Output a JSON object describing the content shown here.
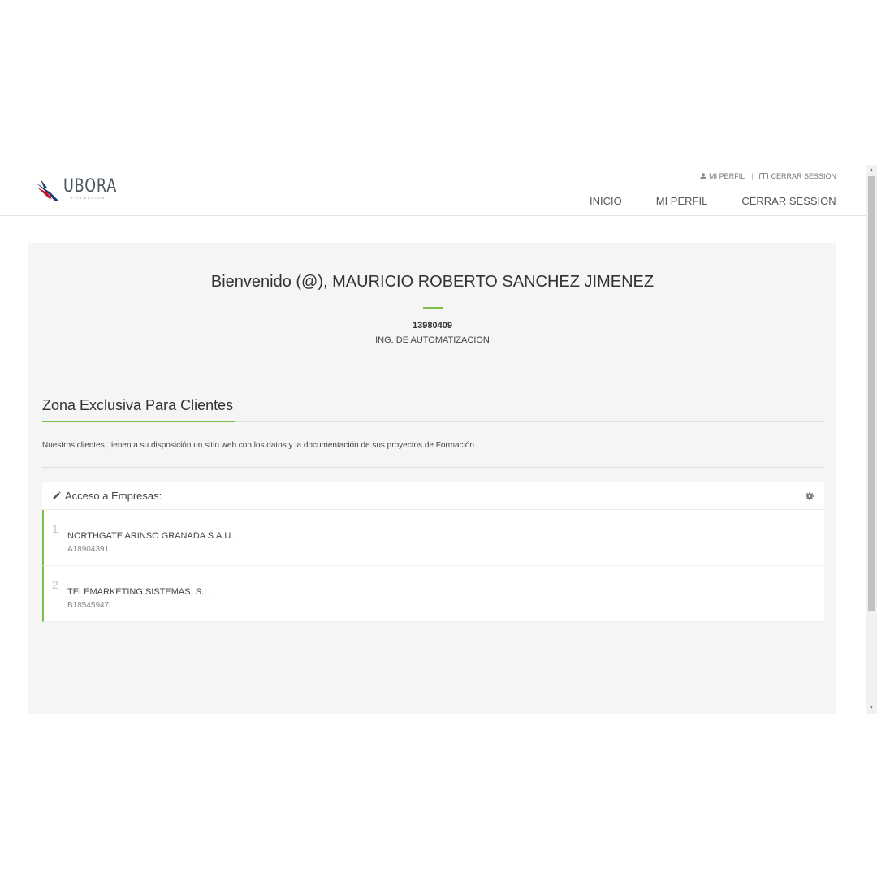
{
  "header": {
    "logo_text": "UBORA",
    "logo_sub": "FORMACION",
    "top_links": {
      "profile": "MI PERFIL",
      "separator": "|",
      "logout": "CERRAR SESSION"
    },
    "nav": [
      "INICIO",
      "MI PERFIL",
      "CERRAR SESSION"
    ]
  },
  "welcome": {
    "greeting": "Bienvenido (@), MAURICIO ROBERTO SANCHEZ JIMENEZ",
    "id": "13980409",
    "role": "ING. DE AUTOMATIZACION"
  },
  "section": {
    "title": "Zona Exclusiva Para Clientes",
    "description": "Nuestros clientes, tienen a su disposición un sitio web con los datos y la documentación de sus proyectos de Formación."
  },
  "card": {
    "title": "Acceso a Empresas:",
    "companies": [
      {
        "num": "1",
        "name": "NORTHGATE ARINSO GRANADA S.A.U.",
        "code": "A18904391"
      },
      {
        "num": "2",
        "name": "TELEMARKETING SISTEMAS, S.L.",
        "code": "B18545947"
      }
    ]
  },
  "colors": {
    "accent": "#7cc04b",
    "panel_bg": "#f5f5f5",
    "logo_red": "#c8102e",
    "logo_blue": "#1f3a6e"
  },
  "icons": [
    "user-icon",
    "logout-icon",
    "pencil-icon",
    "gear-icon"
  ]
}
